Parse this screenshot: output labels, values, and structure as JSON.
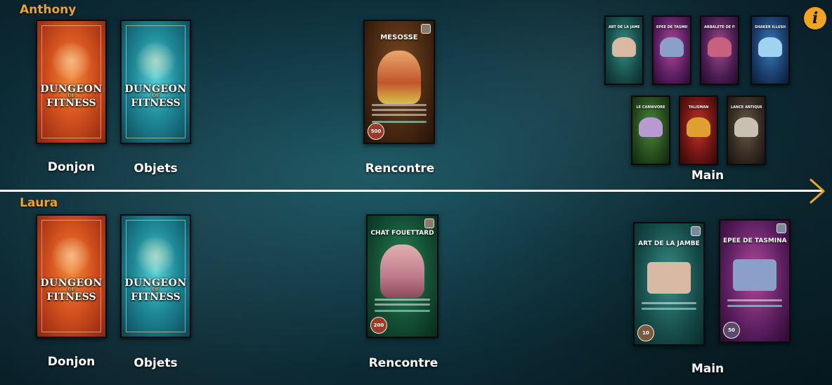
{
  "players": [
    {
      "name": "Anthony",
      "dungeon_label": "Donjon",
      "objects_label": "Objets",
      "encounter_label": "Rencontre",
      "hand_label": "Main",
      "encounter_card": {
        "title": "MESOSSÉ",
        "value": "500"
      },
      "hand": [
        {
          "title": "ART DE LA JAMBE"
        },
        {
          "title": "ÉPÉE DE TASMINA"
        },
        {
          "title": "ARBALÈTE DE FITLAND"
        },
        {
          "title": "SHAKER ILLUSION"
        },
        {
          "title": "LE CARNIVORE"
        },
        {
          "title": "TALISMAN"
        },
        {
          "title": "LANCE ANTIQUE"
        }
      ]
    },
    {
      "name": "Laura",
      "dungeon_label": "Donjon",
      "objects_label": "Objets",
      "encounter_label": "Rencontre",
      "hand_label": "Main",
      "encounter_card": {
        "title": "CHAT FOUETTARD",
        "value": "200"
      },
      "hand": [
        {
          "title": "ART DE LA JAMBE",
          "value": "10"
        },
        {
          "title": "ÉPÉE DE TASMINA",
          "value": "50"
        }
      ]
    }
  ],
  "deck_logo": {
    "line1": "DUNGEON",
    "line2": "OF",
    "line3": "FITNESS"
  },
  "icons": {
    "info": "info-icon",
    "next": "chevron-right-icon"
  },
  "colors": {
    "accent": "#f0a41f",
    "divider": "#ffffff"
  }
}
